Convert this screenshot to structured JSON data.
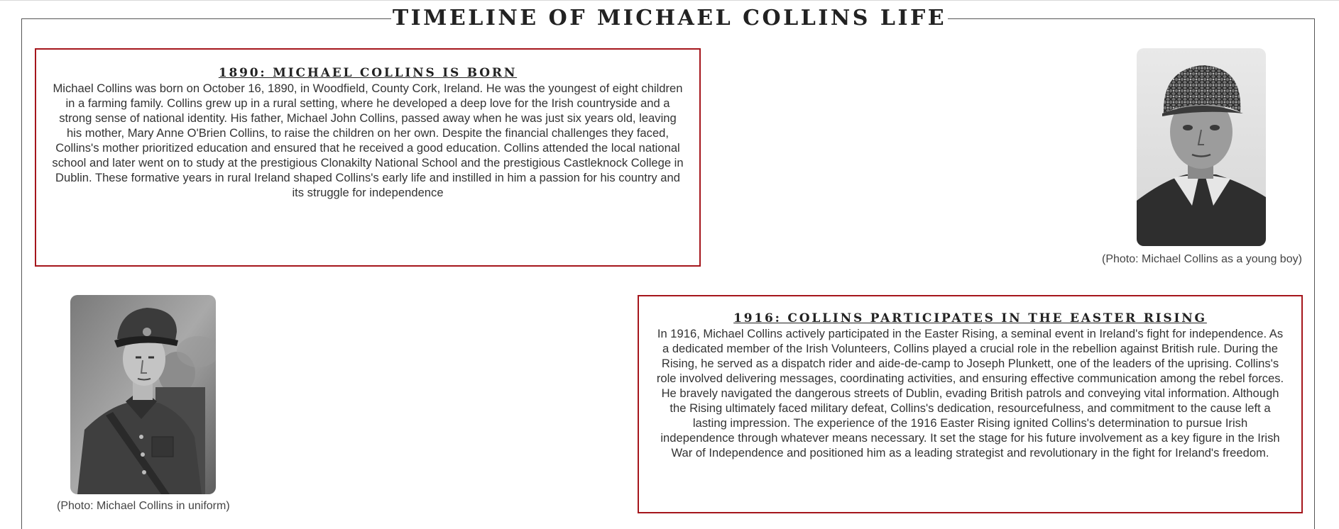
{
  "page": {
    "title": "TIMELINE OF MICHAEL COLLINS LIFE"
  },
  "events": [
    {
      "heading": "1890: MICHAEL COLLINS IS BORN",
      "text": "Michael Collins was born on October 16, 1890, in Woodfield, County Cork, Ireland. He was the youngest of eight children in a farming family. Collins grew up in a rural setting, where he developed a deep love for the Irish countryside and a strong sense of national identity. His father, Michael John Collins, passed away when he was just six years old, leaving his mother, Mary Anne O'Brien Collins, to raise the children on her own. Despite the financial challenges they faced, Collins's mother prioritized education and ensured that he received a good education. Collins attended the local national school and later went on to study at the prestigious Clonakilty National School and the prestigious Castleknock College in Dublin. These formative years in rural Ireland shaped Collins's early life and instilled in him a passion for his country and its struggle for independence",
      "photo_caption": "(Photo: Michael Collins as a young boy)",
      "photo_subject": "young-boy-portrait"
    },
    {
      "heading": "1916: COLLINS PARTICIPATES IN THE EASTER RISING",
      "text": "In 1916, Michael Collins actively participated in the Easter Rising, a seminal event in Ireland's fight for independence. As a dedicated member of the Irish Volunteers, Collins played a crucial role in the rebellion against British rule. During the Rising, he served as a dispatch rider and aide-de-camp to Joseph Plunkett, one of the leaders of the uprising. Collins's role involved delivering messages, coordinating activities, and ensuring effective communication among the rebel forces. He bravely navigated the dangerous streets of Dublin, evading British patrols and conveying vital information. Although the Rising ultimately faced military defeat, Collins's dedication, resourcefulness, and commitment to the cause left a lasting impression. The experience of the 1916 Easter Rising ignited Collins's determination to pursue Irish independence through whatever means necessary. It set the stage for his future involvement as a key figure in the Irish War of Independence and positioned him as a leading strategist and revolutionary in the fight for Ireland's freedom.",
      "photo_caption": "(Photo: Michael Collins in uniform)",
      "photo_subject": "uniform-portrait"
    }
  ],
  "colors": {
    "box_border": "#a5161c",
    "frame_line": "#555555",
    "text": "#333333"
  }
}
